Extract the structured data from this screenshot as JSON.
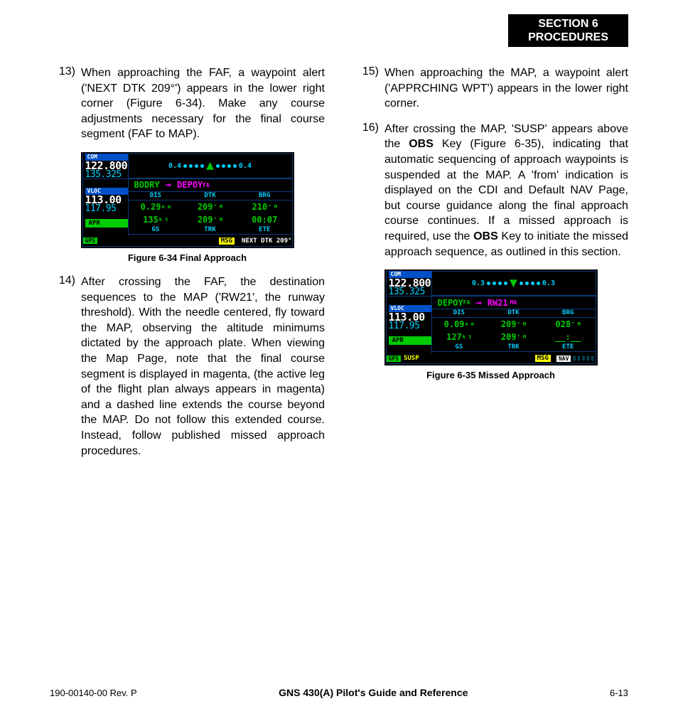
{
  "header": {
    "line1": "SECTION 6",
    "line2": "PROCEDURES"
  },
  "steps": {
    "s13": {
      "num": "13)",
      "text": "When approaching the FAF, a waypoint alert ('NEXT DTK 209°') appears in the lower right corner (Figure 6-34).  Make any course adjustments necessary for the final course segment (FAF to MAP)."
    },
    "s14": {
      "num": "14)",
      "text": "After crossing the FAF, the destination sequences to the MAP ('RW21', the  runway threshold).  With the needle centered, fly toward the MAP, observing the altitude minimums dictated by the approach plate.  When viewing the Map Page, note that the final course segment is displayed in magenta, (the active leg of the flight plan always appears in magenta) and a dashed line extends the course beyond the MAP.  Do not follow this extended course.  Instead, follow published missed approach procedures."
    },
    "s15": {
      "num": "15)",
      "text": "When approaching the MAP, a waypoint alert ('APPRCHING WPT') appears in the lower right corner."
    },
    "s16": {
      "num": "16)",
      "pre": "After crossing the MAP, 'SUSP' appears above the ",
      "obs1": "OBS",
      "mid": " Key (Figure 6-35), indicating that automatic sequencing of approach waypoints is suspended at the MAP.  A 'from' indication is displayed on the CDI and Default NAV Page, but course guidance along the final approach course continues.  If a missed approach is required, use the ",
      "obs2": "OBS",
      "post": " Key to initiate the missed approach sequence, as outlined in this section."
    }
  },
  "fig634": {
    "caption": "Figure 6-34  Final Approach",
    "com_lbl": "COM",
    "com_active": "122.800",
    "com_standby": "135.325",
    "vloc_lbl": "VLOC",
    "vloc_active": "113.00",
    "vloc_standby": "117.95",
    "cdi_left": "0.4",
    "cdi_right": "0.4",
    "leg_from": "BODRY",
    "leg_to": "DEPOY",
    "leg_sfx": "FA",
    "hdr1": "DIS",
    "hdr2": "DTK",
    "hdr3": "BRG",
    "v1a": "0.29",
    "v1a_u": "n m",
    "v1b": "209",
    "v1b_u": "° M",
    "v1c": "210",
    "v1c_u": "° M",
    "v2a": "135",
    "v2a_u": "k t",
    "v2b": "209",
    "v2b_u": "° M",
    "v2c": "00:07",
    "hdr4": "GS",
    "hdr5": "TRK",
    "hdr6": "ETE",
    "apr": "APR",
    "gps": "GPS",
    "msg": "MSG",
    "next": "NEXT DTK 209°"
  },
  "fig635": {
    "caption": "Figure 6-35  Missed Approach",
    "com_lbl": "COM",
    "com_active": "122.800",
    "com_standby": "135.325",
    "vloc_lbl": "VLOC",
    "vloc_active": "113.00",
    "vloc_standby": "117.95",
    "cdi_left": "0.3",
    "cdi_right": "0.3",
    "leg_from": "DEPOY",
    "leg_from_sfx": "FA",
    "leg_to": "RW21",
    "leg_to_sfx": "MA",
    "hdr1": "DIS",
    "hdr2": "DTK",
    "hdr3": "BRG",
    "v1a": "0.09",
    "v1a_u": "n m",
    "v1b": "209",
    "v1b_u": "° M",
    "v1c": "028",
    "v1c_u": "° M",
    "v2a": "127",
    "v2a_u": "k t",
    "v2b": "209",
    "v2b_u": "° M",
    "v2c": "__:__",
    "hdr4": "GS",
    "hdr5": "TRK",
    "hdr6": "ETE",
    "apr": "APR",
    "gps": "GPS",
    "susp": "SUSP",
    "msg": "MSG",
    "nav": "NAV",
    "boxes": "▯▯▯▯▯"
  },
  "footer": {
    "left": "190-00140-00  Rev. P",
    "center": "GNS 430(A) Pilot's Guide and Reference",
    "right": "6-13"
  }
}
